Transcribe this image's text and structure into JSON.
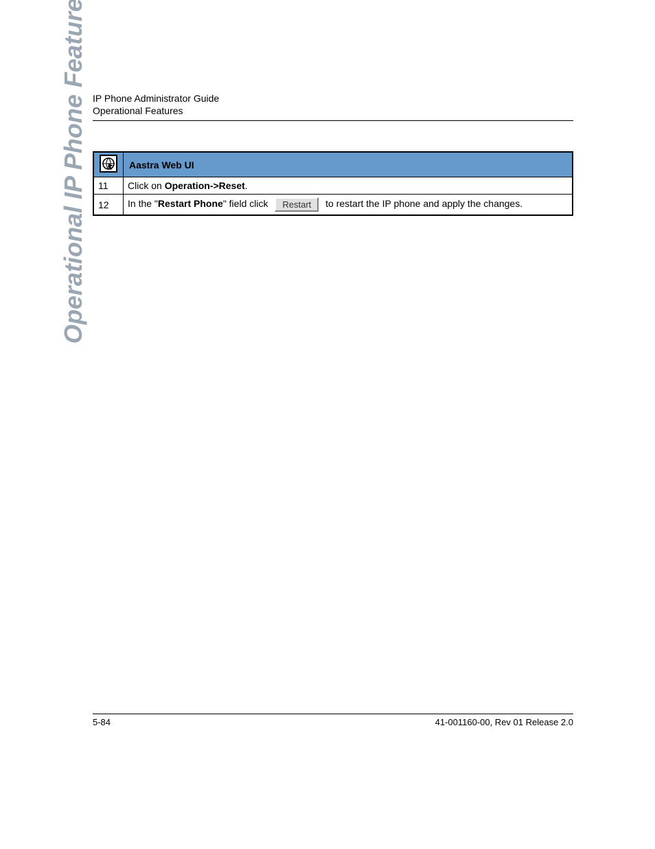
{
  "header": {
    "line1": "IP Phone Administrator Guide",
    "line2": "Operational Features"
  },
  "side_tab": "Operational IP Phone Features",
  "table": {
    "title": "Aastra Web UI",
    "rows": [
      {
        "num": "11",
        "text_before": "Click on ",
        "bold1": "Operation->Reset",
        "text_after": "."
      },
      {
        "num": "12",
        "text_before": "In the \"",
        "bold1": "Restart Phone",
        "mid": "\" field click ",
        "button": "Restart",
        "text_after": " to restart the IP phone and apply the changes."
      }
    ]
  },
  "footer": {
    "left": "5-84",
    "right": "41-001160-00, Rev 01  Release 2.0"
  }
}
